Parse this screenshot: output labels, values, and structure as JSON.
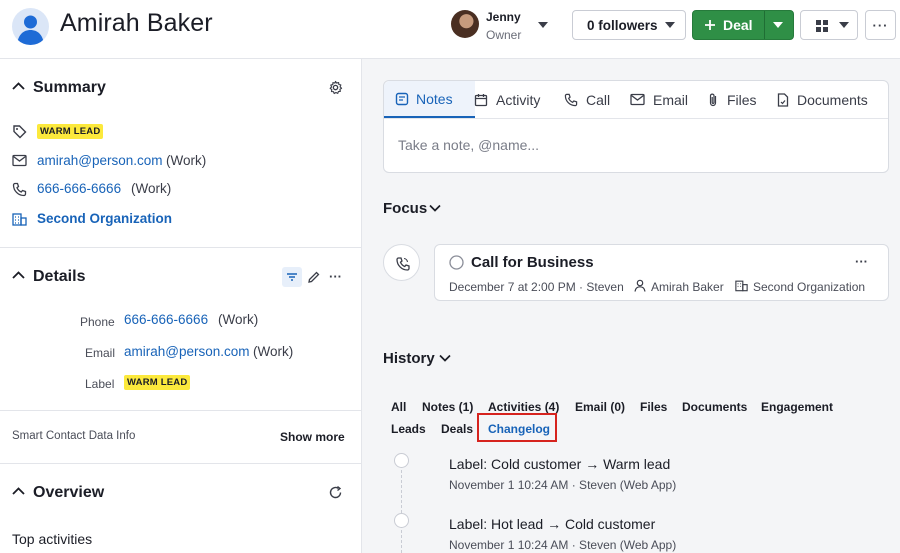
{
  "header": {
    "title": "Amirah Baker",
    "owner_name": "Jenny",
    "owner_role": "Owner",
    "followers_label": "0 followers",
    "deal_label": "Deal",
    "more_label": "···"
  },
  "summary": {
    "title": "Summary",
    "tag": "WARM LEAD",
    "email": "amirah@person.com",
    "email_type": "(Work)",
    "phone": "666-666-6666",
    "phone_type": "(Work)",
    "organization": "Second Organization"
  },
  "details": {
    "title": "Details",
    "phone_label": "Phone",
    "phone_value": "666-666-6666",
    "phone_type": "(Work)",
    "email_label": "Email",
    "email_value": "amirah@person.com",
    "email_type": "(Work)",
    "label_label": "Label",
    "label_value": "WARM LEAD",
    "smart_info": "Smart Contact Data Info",
    "show_more": "Show more"
  },
  "overview": {
    "title": "Overview",
    "top_activities": "Top activities"
  },
  "compose": {
    "tabs": [
      "Notes",
      "Activity",
      "Call",
      "Email",
      "Files",
      "Documents"
    ],
    "placeholder": "Take a note, @name..."
  },
  "focus": {
    "title": "Focus",
    "activity_title": "Call for Business",
    "activity_date": "December 7 at 2:00 PM · Steven",
    "activity_person": "Amirah Baker",
    "activity_org": "Second Organization",
    "more_label": "···"
  },
  "history": {
    "title": "History",
    "tabs_row1": [
      "All",
      "Notes (1)",
      "Activities (4)",
      "Email (0)",
      "Files",
      "Documents",
      "Engagement"
    ],
    "tabs_row2": [
      "Leads",
      "Deals",
      "Changelog"
    ],
    "entries": [
      {
        "field": "Label",
        "change": "Cold customer → Warm lead",
        "meta": "November 1 10:24 AM · Steven (Web App)"
      },
      {
        "field": "Label",
        "change": "Hot lead → Cold customer",
        "meta": "November 1 10:24 AM · Steven (Web App)"
      }
    ]
  },
  "colors": {
    "accent": "#1863b8",
    "deal_green": "#2f8f46",
    "badge_yellow": "#fce93c",
    "highlight_red": "#d6231e"
  }
}
